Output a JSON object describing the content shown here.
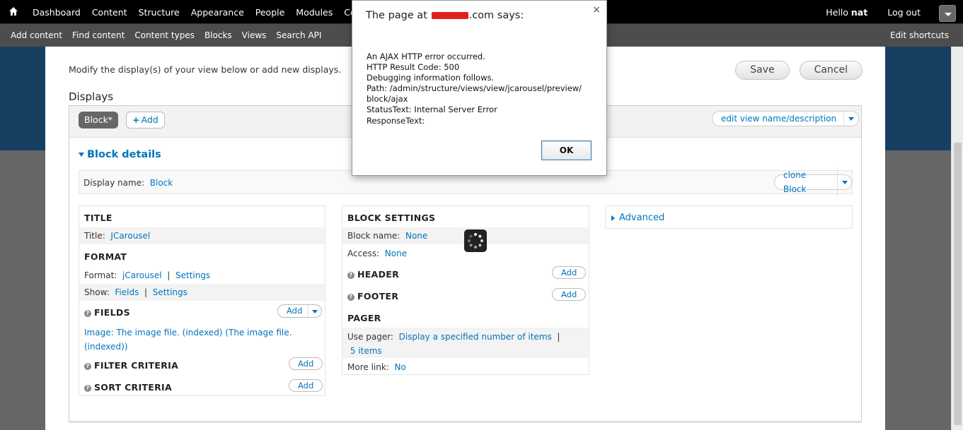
{
  "toolbar": {
    "menu": [
      "Dashboard",
      "Content",
      "Structure",
      "Appearance",
      "People",
      "Modules",
      "Con"
    ],
    "hello": "Hello",
    "username": "nat",
    "logout": "Log out"
  },
  "shortcuts": {
    "items": [
      "Add content",
      "Find content",
      "Content types",
      "Blocks",
      "Views",
      "Search API"
    ],
    "edit": "Edit shortcuts"
  },
  "page": {
    "intro": "Modify the display(s) of your view below or add new displays.",
    "save": "Save",
    "cancel": "Cancel",
    "displays_title": "Displays"
  },
  "displays": {
    "active_tab": "Block*",
    "add_tab": "Add",
    "edit_view": "edit view name/description",
    "details_title": "Block details",
    "display_name_label": "Display name:",
    "display_name_value": "Block",
    "clone": "clone Block"
  },
  "left": {
    "title_heading": "TITLE",
    "title_label": "Title:",
    "title_value": "JCarousel",
    "format_heading": "FORMAT",
    "format_label": "Format:",
    "format_value": "jCarousel",
    "format_sep": "|",
    "format_settings": "Settings",
    "show_label": "Show:",
    "show_value": "Fields",
    "show_sep": "|",
    "show_settings": "Settings",
    "fields_heading": "FIELDS",
    "fields_add": "Add",
    "field_item": "Image: The image file. (indexed) (The image file. (indexed))",
    "filter_heading": "FILTER CRITERIA",
    "filter_add": "Add",
    "sort_heading": "SORT CRITERIA",
    "sort_add": "Add"
  },
  "middle": {
    "block_settings_heading": "BLOCK SETTINGS",
    "block_name_label": "Block name:",
    "block_name_value": "None",
    "access_label": "Access:",
    "access_value": "None",
    "header_heading": "HEADER",
    "header_add": "Add",
    "footer_heading": "FOOTER",
    "footer_add": "Add",
    "pager_heading": "PAGER",
    "use_pager_label": "Use pager:",
    "use_pager_value": "Display a specified number of items",
    "use_pager_sep": "|",
    "pager_items": "5 items",
    "more_link_label": "More link:",
    "more_link_value": "No"
  },
  "right": {
    "advanced": "Advanced"
  },
  "dialog": {
    "title_prefix": "The page at",
    "title_suffix": ".com says:",
    "close": "×",
    "lines": [
      "An AJAX HTTP error occurred.",
      "HTTP Result Code: 500",
      "Debugging information follows.",
      "Path: /admin/structure/views/view/jcarousel/preview/",
      "block/ajax",
      "StatusText: Internal Server Error",
      "ResponseText:"
    ],
    "ok": "OK"
  },
  "icons": {
    "home": "home-icon",
    "help": "question-icon",
    "spinner": "loading-spinner-icon"
  }
}
